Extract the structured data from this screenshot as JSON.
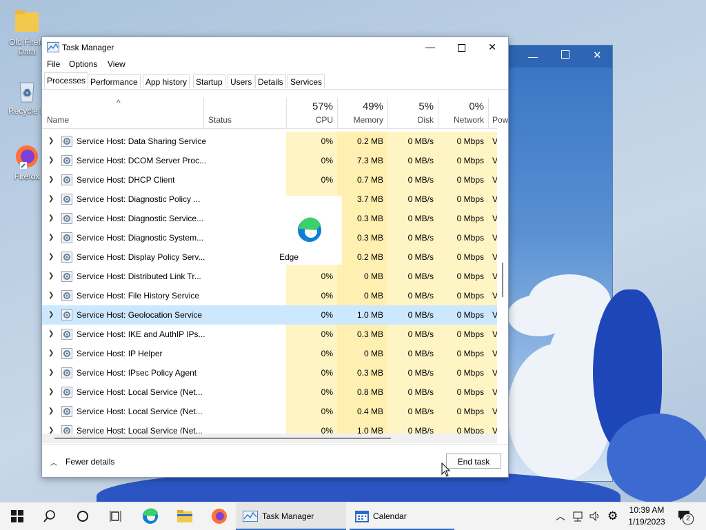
{
  "desktop": {
    "icons": [
      {
        "label": "Old Firefox Data",
        "label_visible": "Old Firefc Data"
      },
      {
        "label": "Recycle Bin",
        "label_visible": "Recycle B"
      },
      {
        "label": "Firefox",
        "label_visible": "Firefox"
      }
    ]
  },
  "window": {
    "title": "Task Manager",
    "minimize": "—",
    "maximize": "☐",
    "close": "✕"
  },
  "menu": [
    "File",
    "Options",
    "View"
  ],
  "tabs": [
    "Processes",
    "Performance",
    "App history",
    "Startup",
    "Users",
    "Details",
    "Services"
  ],
  "active_tab": "Processes",
  "columns": {
    "sort_arrow": "^",
    "name": "Name",
    "status": "Status",
    "cpu": {
      "pct": "57%",
      "label": "CPU"
    },
    "memory": {
      "pct": "49%",
      "label": "Memory"
    },
    "disk": {
      "pct": "5%",
      "label": "Disk"
    },
    "network": {
      "pct": "0%",
      "label": "Network"
    },
    "power": {
      "label": "Pow"
    }
  },
  "rows": [
    {
      "name": "Service Host: Data Sharing Service",
      "cpu": "0%",
      "memory": "0.2 MB",
      "disk": "0 MB/s",
      "network": "0 Mbps",
      "power": "V"
    },
    {
      "name": "Service Host: DCOM Server Proc...",
      "cpu": "0%",
      "memory": "7.3 MB",
      "disk": "0 MB/s",
      "network": "0 Mbps",
      "power": "V"
    },
    {
      "name": "Service Host: DHCP Client",
      "cpu": "0%",
      "memory": "0.7 MB",
      "disk": "0 MB/s",
      "network": "0 Mbps",
      "power": "V"
    },
    {
      "name": "Service Host: Diagnostic Policy ...",
      "cpu": "",
      "memory": "3.7 MB",
      "disk": "0 MB/s",
      "network": "0 Mbps",
      "power": "V"
    },
    {
      "name": "Service Host: Diagnostic Service...",
      "cpu": "",
      "memory": "0.3 MB",
      "disk": "0 MB/s",
      "network": "0 Mbps",
      "power": "V"
    },
    {
      "name": "Service Host: Diagnostic System...",
      "cpu": "",
      "memory": "0.3 MB",
      "disk": "0 MB/s",
      "network": "0 Mbps",
      "power": "V"
    },
    {
      "name": "Service Host: Display Policy Serv...",
      "cpu": "",
      "memory": "0.2 MB",
      "disk": "0 MB/s",
      "network": "0 Mbps",
      "power": "V"
    },
    {
      "name": "Service Host: Distributed Link Tr...",
      "cpu": "0%",
      "memory": "0 MB",
      "disk": "0 MB/s",
      "network": "0 Mbps",
      "power": "V"
    },
    {
      "name": "Service Host: File History Service",
      "cpu": "0%",
      "memory": "0 MB",
      "disk": "0 MB/s",
      "network": "0 Mbps",
      "power": "V"
    },
    {
      "name": "Service Host: Geolocation Service",
      "cpu": "0%",
      "memory": "1.0 MB",
      "disk": "0 MB/s",
      "network": "0 Mbps",
      "power": "V"
    },
    {
      "name": "Service Host: IKE and AuthIP IPs...",
      "cpu": "0%",
      "memory": "0.3 MB",
      "disk": "0 MB/s",
      "network": "0 Mbps",
      "power": "V"
    },
    {
      "name": "Service Host: IP Helper",
      "cpu": "0%",
      "memory": "0 MB",
      "disk": "0 MB/s",
      "network": "0 Mbps",
      "power": "V"
    },
    {
      "name": "Service Host: IPsec Policy Agent",
      "cpu": "0%",
      "memory": "0.3 MB",
      "disk": "0 MB/s",
      "network": "0 Mbps",
      "power": "V"
    },
    {
      "name": "Service Host: Local Service (Net...",
      "cpu": "0%",
      "memory": "0.8 MB",
      "disk": "0 MB/s",
      "network": "0 Mbps",
      "power": "V"
    },
    {
      "name": "Service Host: Local Service (Net...",
      "cpu": "0%",
      "memory": "0.4 MB",
      "disk": "0 MB/s",
      "network": "0 Mbps",
      "power": "V"
    },
    {
      "name": "Service Host: Local Service (Net...",
      "cpu": "0%",
      "memory": "1.0 MB",
      "disk": "0 MB/s",
      "network": "0 Mbps",
      "power": "V"
    }
  ],
  "selected_row": 9,
  "drag_tooltip": {
    "label": "Edge"
  },
  "footer": {
    "fewer_details": "Fewer details",
    "end_task": "End task"
  },
  "taskbar": {
    "apps": [
      {
        "label": "Task Manager",
        "icon": "task-manager-icon"
      },
      {
        "label": "Calendar",
        "icon": "calendar-icon"
      }
    ],
    "notification_count": "2",
    "time": "10:39 AM",
    "date": "1/19/2023"
  },
  "colors": {
    "accent": "#2b6cc4",
    "selection": "#cce8ff",
    "heat": "#fff4c4"
  }
}
